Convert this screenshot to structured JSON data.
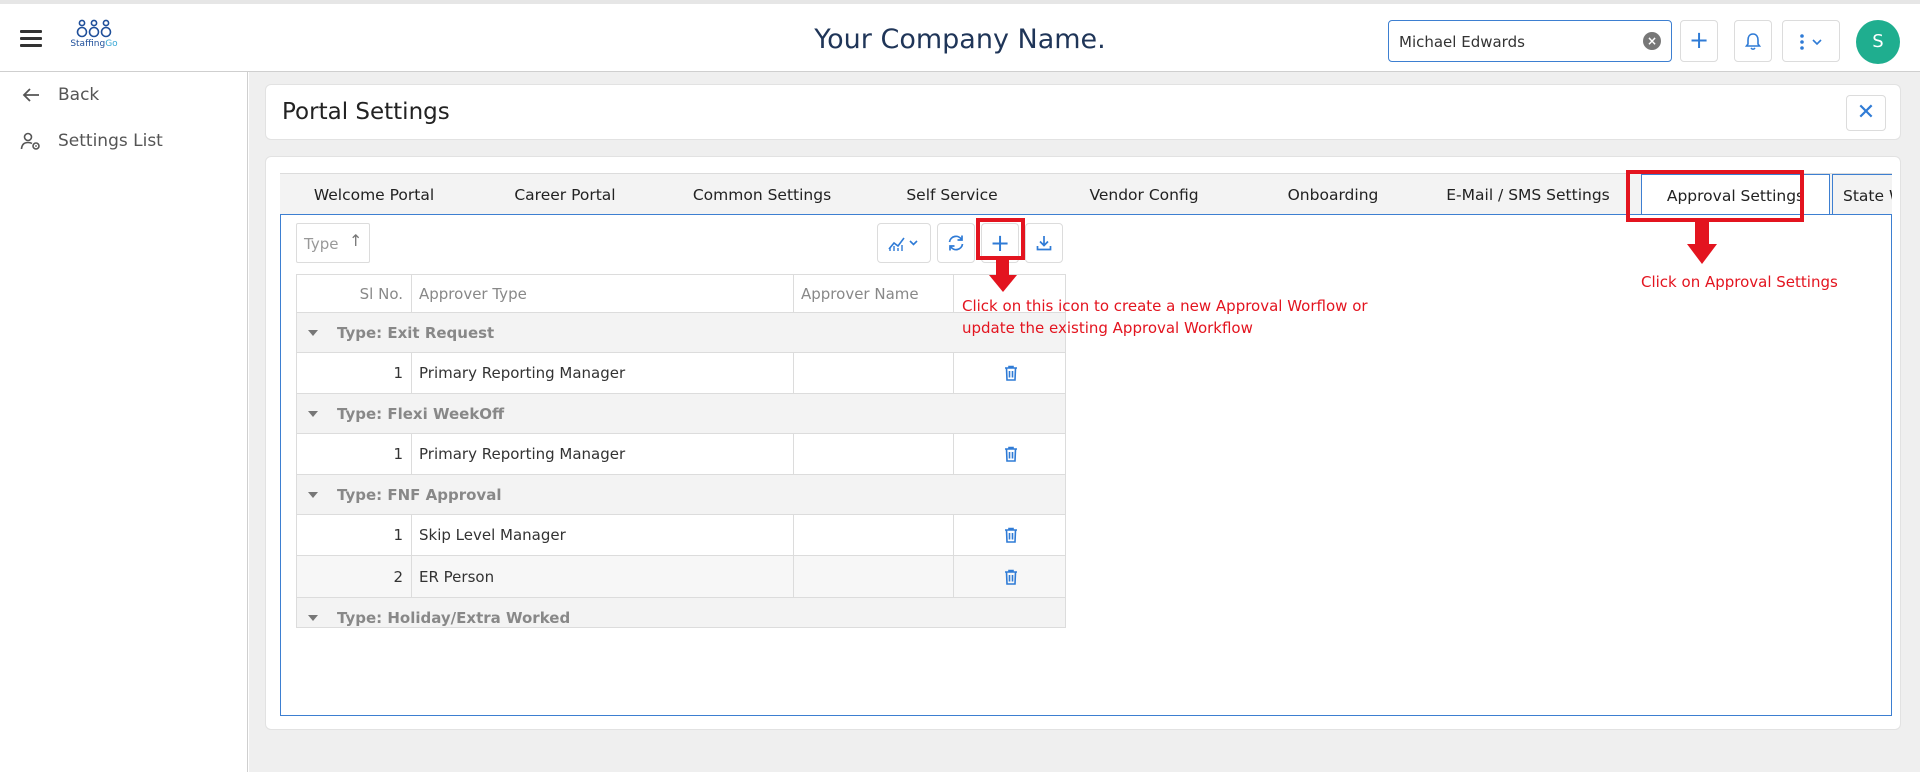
{
  "brand": {
    "logo_text": "Staffing",
    "logo_text_accent": "Go"
  },
  "header": {
    "company_name": "Your Company Name.",
    "user_value": "Michael Edwards",
    "avatar_initial": "S"
  },
  "sidebar": {
    "items": [
      {
        "label": "Back",
        "icon": "arrow-left-icon"
      },
      {
        "label": "Settings List",
        "icon": "user-settings-icon"
      }
    ]
  },
  "page": {
    "title": "Portal Settings"
  },
  "tabs": [
    {
      "label": "Welcome Portal"
    },
    {
      "label": "Career Portal"
    },
    {
      "label": "Common Settings"
    },
    {
      "label": "Self Service"
    },
    {
      "label": "Vendor Config"
    },
    {
      "label": "Onboarding"
    },
    {
      "label": "E-Mail / SMS Settings"
    },
    {
      "label": "Approval Settings",
      "active": true
    },
    {
      "label": "State W"
    }
  ],
  "toolbar": {
    "sort_label": "Type"
  },
  "grid": {
    "columns": [
      "Sl No.",
      "Approver Type",
      "Approver Name",
      ""
    ],
    "rows": [
      {
        "kind": "group",
        "label": "Type: Exit Request"
      },
      {
        "kind": "data",
        "sl": "1",
        "approver_type": "Primary Reporting Manager",
        "approver_name": ""
      },
      {
        "kind": "group",
        "label": "Type: Flexi WeekOff"
      },
      {
        "kind": "data",
        "sl": "1",
        "approver_type": "Primary Reporting Manager",
        "approver_name": ""
      },
      {
        "kind": "group",
        "label": "Type: FNF Approval"
      },
      {
        "kind": "data",
        "sl": "1",
        "approver_type": "Skip Level Manager",
        "approver_name": ""
      },
      {
        "kind": "data",
        "sl": "2",
        "approver_type": "ER Person",
        "approver_name": ""
      },
      {
        "kind": "group",
        "label": "Type: Holiday/Extra Worked"
      }
    ]
  },
  "annotations": {
    "add_note": "Click on this icon to create a new Approval Worflow or update the existing Approval Workflow",
    "tab_note": "Click on Approval Settings"
  },
  "colors": {
    "annotation": "#e3141f",
    "accent": "#2f7bd6",
    "avatar": "#1fae8f"
  }
}
